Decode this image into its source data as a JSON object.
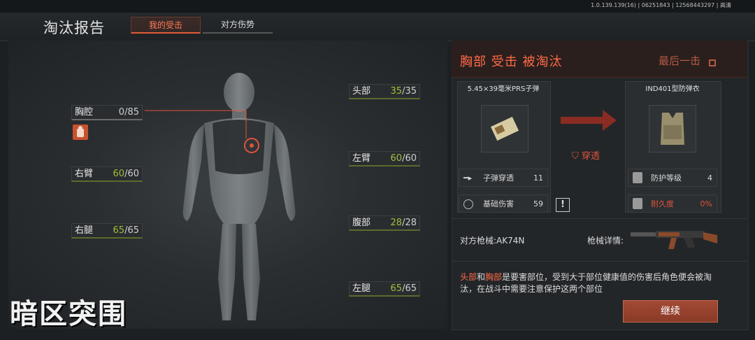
{
  "top_info": "1.0.139.139(16) | 06251843 | 12568443297 | 高清",
  "header": {
    "title": "淘汰报告",
    "tabs": [
      {
        "label": "我的受击",
        "active": true
      },
      {
        "label": "对方伤势",
        "active": false
      }
    ]
  },
  "body_parts": [
    {
      "name": "胸腔",
      "current": "0",
      "max": "/85",
      "status": "destroyed"
    },
    {
      "name": "右臂",
      "current": "60",
      "max": "/60"
    },
    {
      "name": "右腿",
      "current": "65",
      "max": "/65"
    },
    {
      "name": "头部",
      "current": "35",
      "max": "/35"
    },
    {
      "name": "左臂",
      "current": "60",
      "max": "/60"
    },
    {
      "name": "腹部",
      "current": "28",
      "max": "/28"
    },
    {
      "name": "左腿",
      "current": "65",
      "max": "/65"
    }
  ],
  "summary": {
    "title": "胸部  受击  被淘汰",
    "last_blow": "最后一击"
  },
  "ammo": {
    "name": "5.45×39毫米PRS子弹",
    "stats": [
      {
        "label": "子弹穿透",
        "value": "11"
      },
      {
        "label": "基础伤害",
        "value": "59"
      }
    ]
  },
  "penetration_label": "穿透",
  "warning_glyph": "!",
  "armor": {
    "name": "IND401型防弹衣",
    "stats": [
      {
        "label": "防护等级",
        "value": "4"
      },
      {
        "label": "耐久度",
        "value": "0%"
      }
    ]
  },
  "enemy_weapon": {
    "label": "对方枪械:AK74N",
    "details_label": "枪械详情:"
  },
  "description": {
    "part1": "头部",
    "and": "和",
    "part2": "胸部",
    "text": "是要害部位，受到大于部位健康值的伤害后角色便会被淘汰，在战斗中需要注意保护这两个部位"
  },
  "continue_label": "继续",
  "logo_text": "暗区突围",
  "colors": {
    "accent": "#ff6a47",
    "health_ok": "#9fbf3a",
    "button": "#963f2c"
  }
}
